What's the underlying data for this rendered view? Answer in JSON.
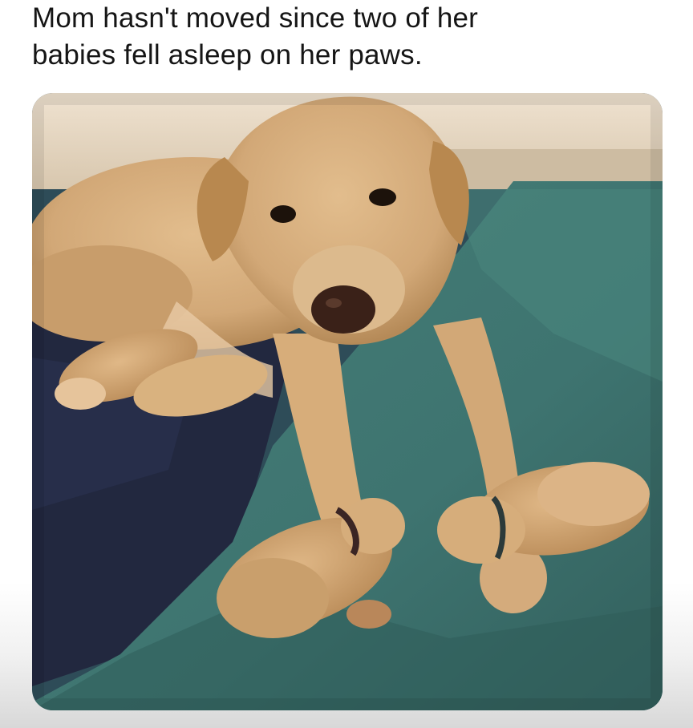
{
  "post": {
    "caption_line1": "Mom hasn't moved since two of her",
    "caption_line2": "babies fell asleep on her paws."
  },
  "colors": {
    "fur": "#d2a877",
    "fur_shadow": "#a9804f",
    "blanket": "#3f7a72",
    "blanket_dark": "#2b5b58",
    "navy_sheet": "#22283f",
    "wall": "#ebdcc8"
  },
  "photo": {
    "subject_icons": [
      "mother-dog-icon",
      "puppy-icon"
    ]
  }
}
